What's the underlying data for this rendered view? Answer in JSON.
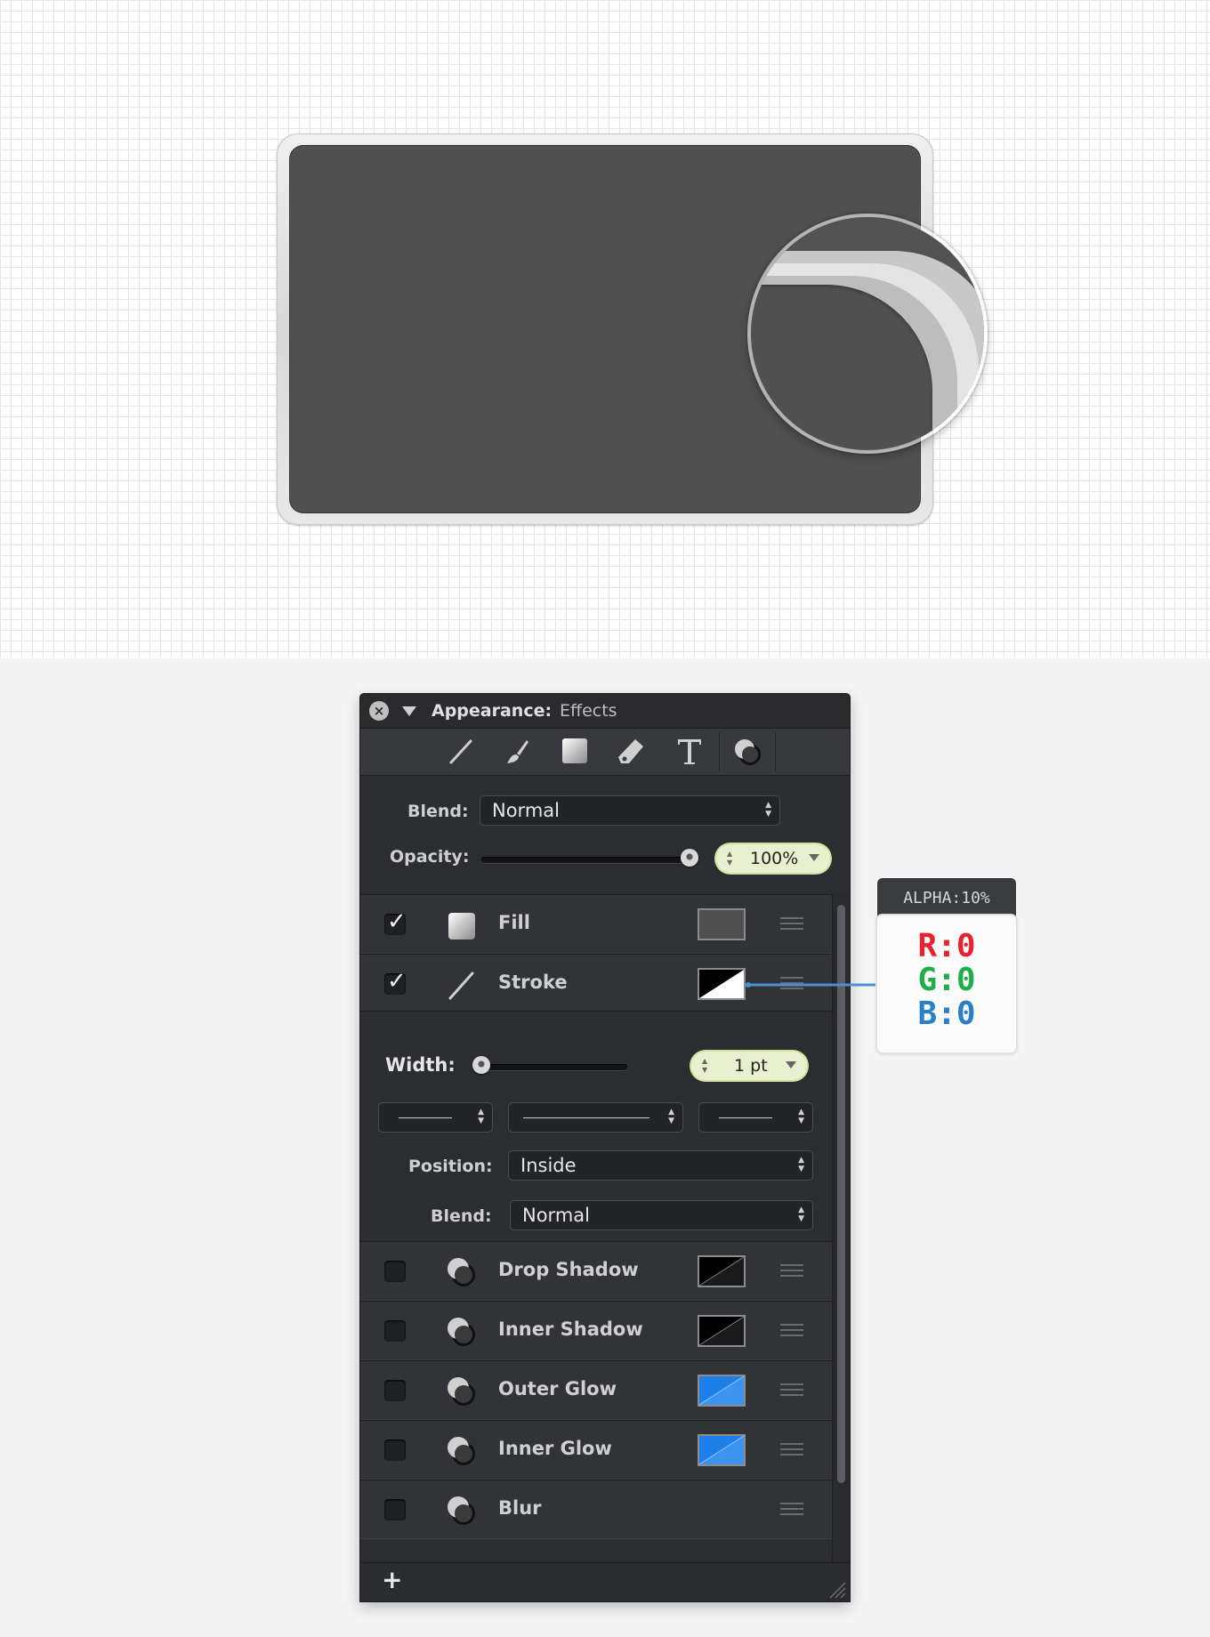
{
  "panel": {
    "title": "Appearance:",
    "subtitle": "Effects",
    "close_glyph": "×",
    "toolbar_icons": [
      "line-tool-icon",
      "brush-tool-icon",
      "fill-tool-icon",
      "eraser-tool-icon",
      "text-tool-icon",
      "effects-tool-icon"
    ],
    "blend_label": "Blend:",
    "blend_value": "Normal",
    "opacity_label": "Opacity:",
    "opacity_value": "100%",
    "opacity_level": 1.0
  },
  "effects": {
    "fill": {
      "label": "Fill",
      "checked": true,
      "color": "#4f4f4f"
    },
    "stroke": {
      "label": "Stroke",
      "checked": true,
      "color": "#000000"
    },
    "drop_shadow": {
      "label": "Drop Shadow",
      "checked": false,
      "color": "#000000"
    },
    "inner_shadow": {
      "label": "Inner Shadow",
      "checked": false,
      "color": "#000000"
    },
    "outer_glow": {
      "label": "Outer Glow",
      "checked": false,
      "color": "#1e90ff"
    },
    "inner_glow": {
      "label": "Inner Glow",
      "checked": false,
      "color": "#1e90ff"
    },
    "blur": {
      "label": "Blur",
      "checked": false
    }
  },
  "stroke_settings": {
    "width_label": "Width:",
    "width_value": "1 pt",
    "width_level": 0.0,
    "position_label": "Position:",
    "position_value": "Inside",
    "blend_label": "Blend:",
    "blend_value": "Normal"
  },
  "footer": {
    "add_glyph": "+"
  },
  "callout": {
    "alpha": "ALPHA:10%",
    "r": "R:0",
    "g": "G:0",
    "b": "B:0",
    "r_color": "#e8222e",
    "g_color": "#1fae4b",
    "b_color": "#2a80c8"
  },
  "colors": {
    "card_face": "#505050",
    "stepper_bg": "#e9f0cf",
    "connector": "#4a90d9"
  }
}
